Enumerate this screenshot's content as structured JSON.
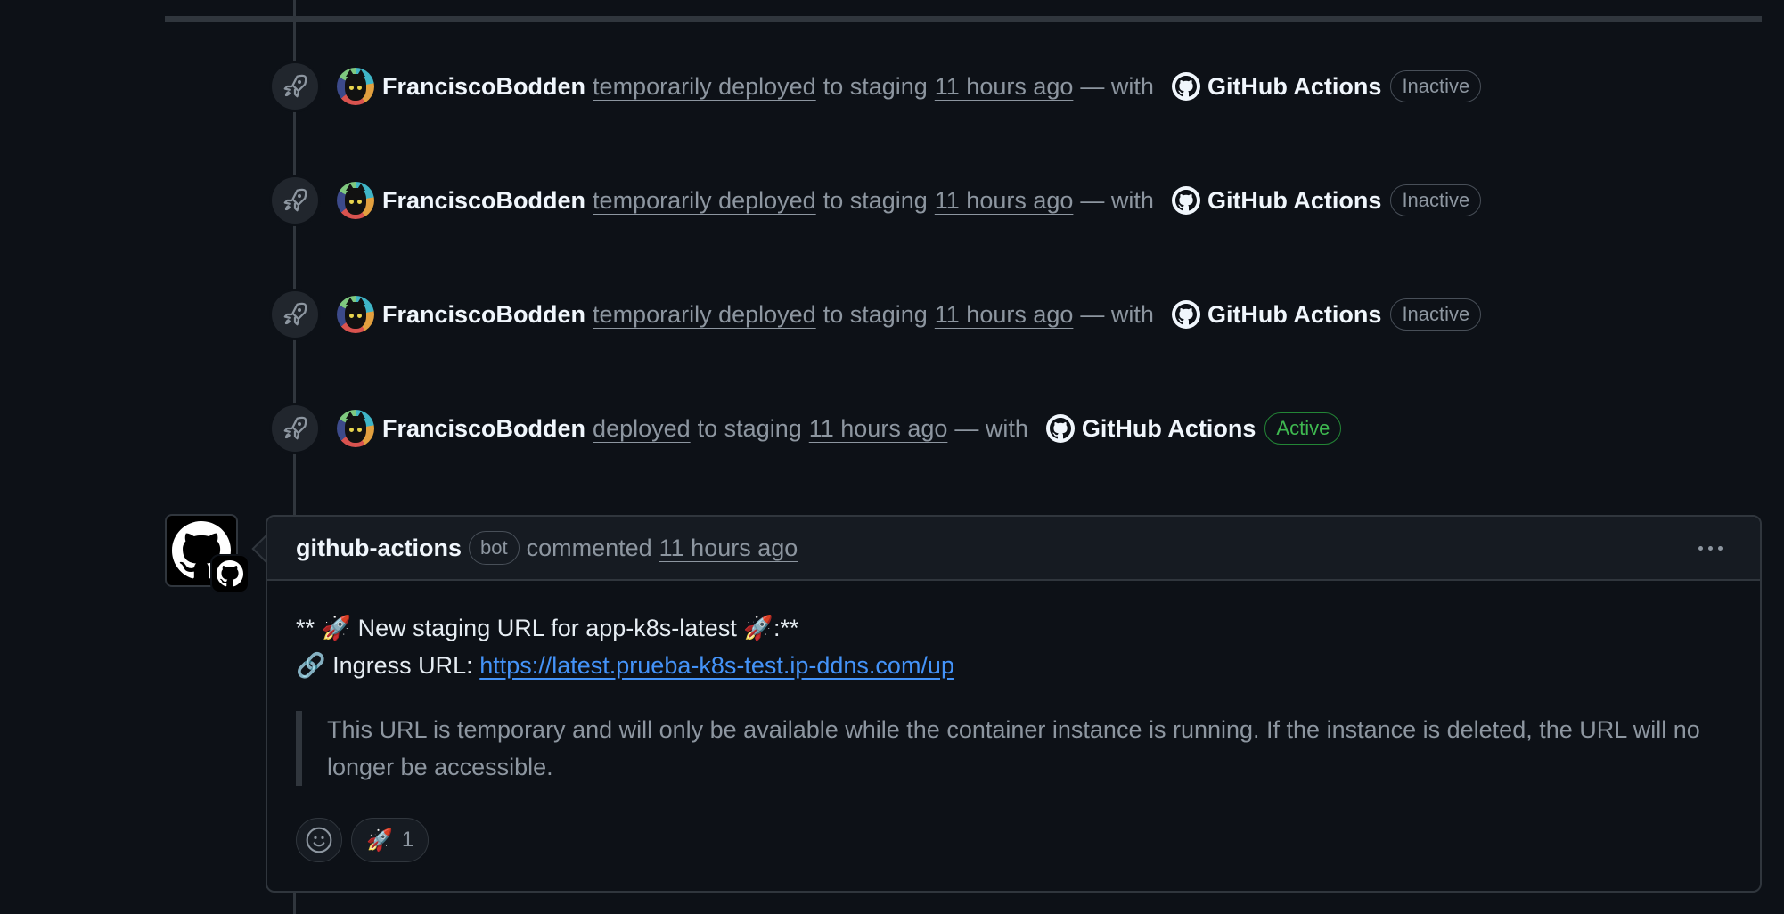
{
  "timeline": {
    "events": [
      {
        "actor": "FranciscoBodden",
        "action": "temporarily deployed",
        "target": "to staging",
        "time": "11 hours ago",
        "with": "— with",
        "app": "GitHub Actions",
        "status": "Inactive"
      },
      {
        "actor": "FranciscoBodden",
        "action": "temporarily deployed",
        "target": "to staging",
        "time": "11 hours ago",
        "with": "— with",
        "app": "GitHub Actions",
        "status": "Inactive"
      },
      {
        "actor": "FranciscoBodden",
        "action": "temporarily deployed",
        "target": "to staging",
        "time": "11 hours ago",
        "with": "— with",
        "app": "GitHub Actions",
        "status": "Inactive"
      },
      {
        "actor": "FranciscoBodden",
        "action": "deployed",
        "target": "to staging",
        "time": "11 hours ago",
        "with": "— with",
        "app": "GitHub Actions",
        "status": "Active"
      }
    ]
  },
  "comment": {
    "author": "github-actions",
    "bot_label": "bot",
    "verb": "commented",
    "time": "11 hours ago",
    "line1": "** 🚀 New staging URL for app-k8s-latest 🚀:**",
    "line2_prefix": "🔗 Ingress URL:",
    "url": "https://latest.prueba-k8s-test.ip-ddns.com/up",
    "quote": "This URL is temporary and will only be available while the container instance is running. If the instance is deleted, the URL will no longer be accessible.",
    "reaction": {
      "emoji": "🚀",
      "count": "1"
    }
  },
  "icons": {
    "event_badge": "rocket-icon",
    "app_icon": "github-mark-icon",
    "add_reaction": "smiley-icon",
    "menu": "kebab-icon"
  },
  "colors": {
    "background": "#0d1117",
    "active": "#3fb950",
    "link": "#4493f8"
  }
}
